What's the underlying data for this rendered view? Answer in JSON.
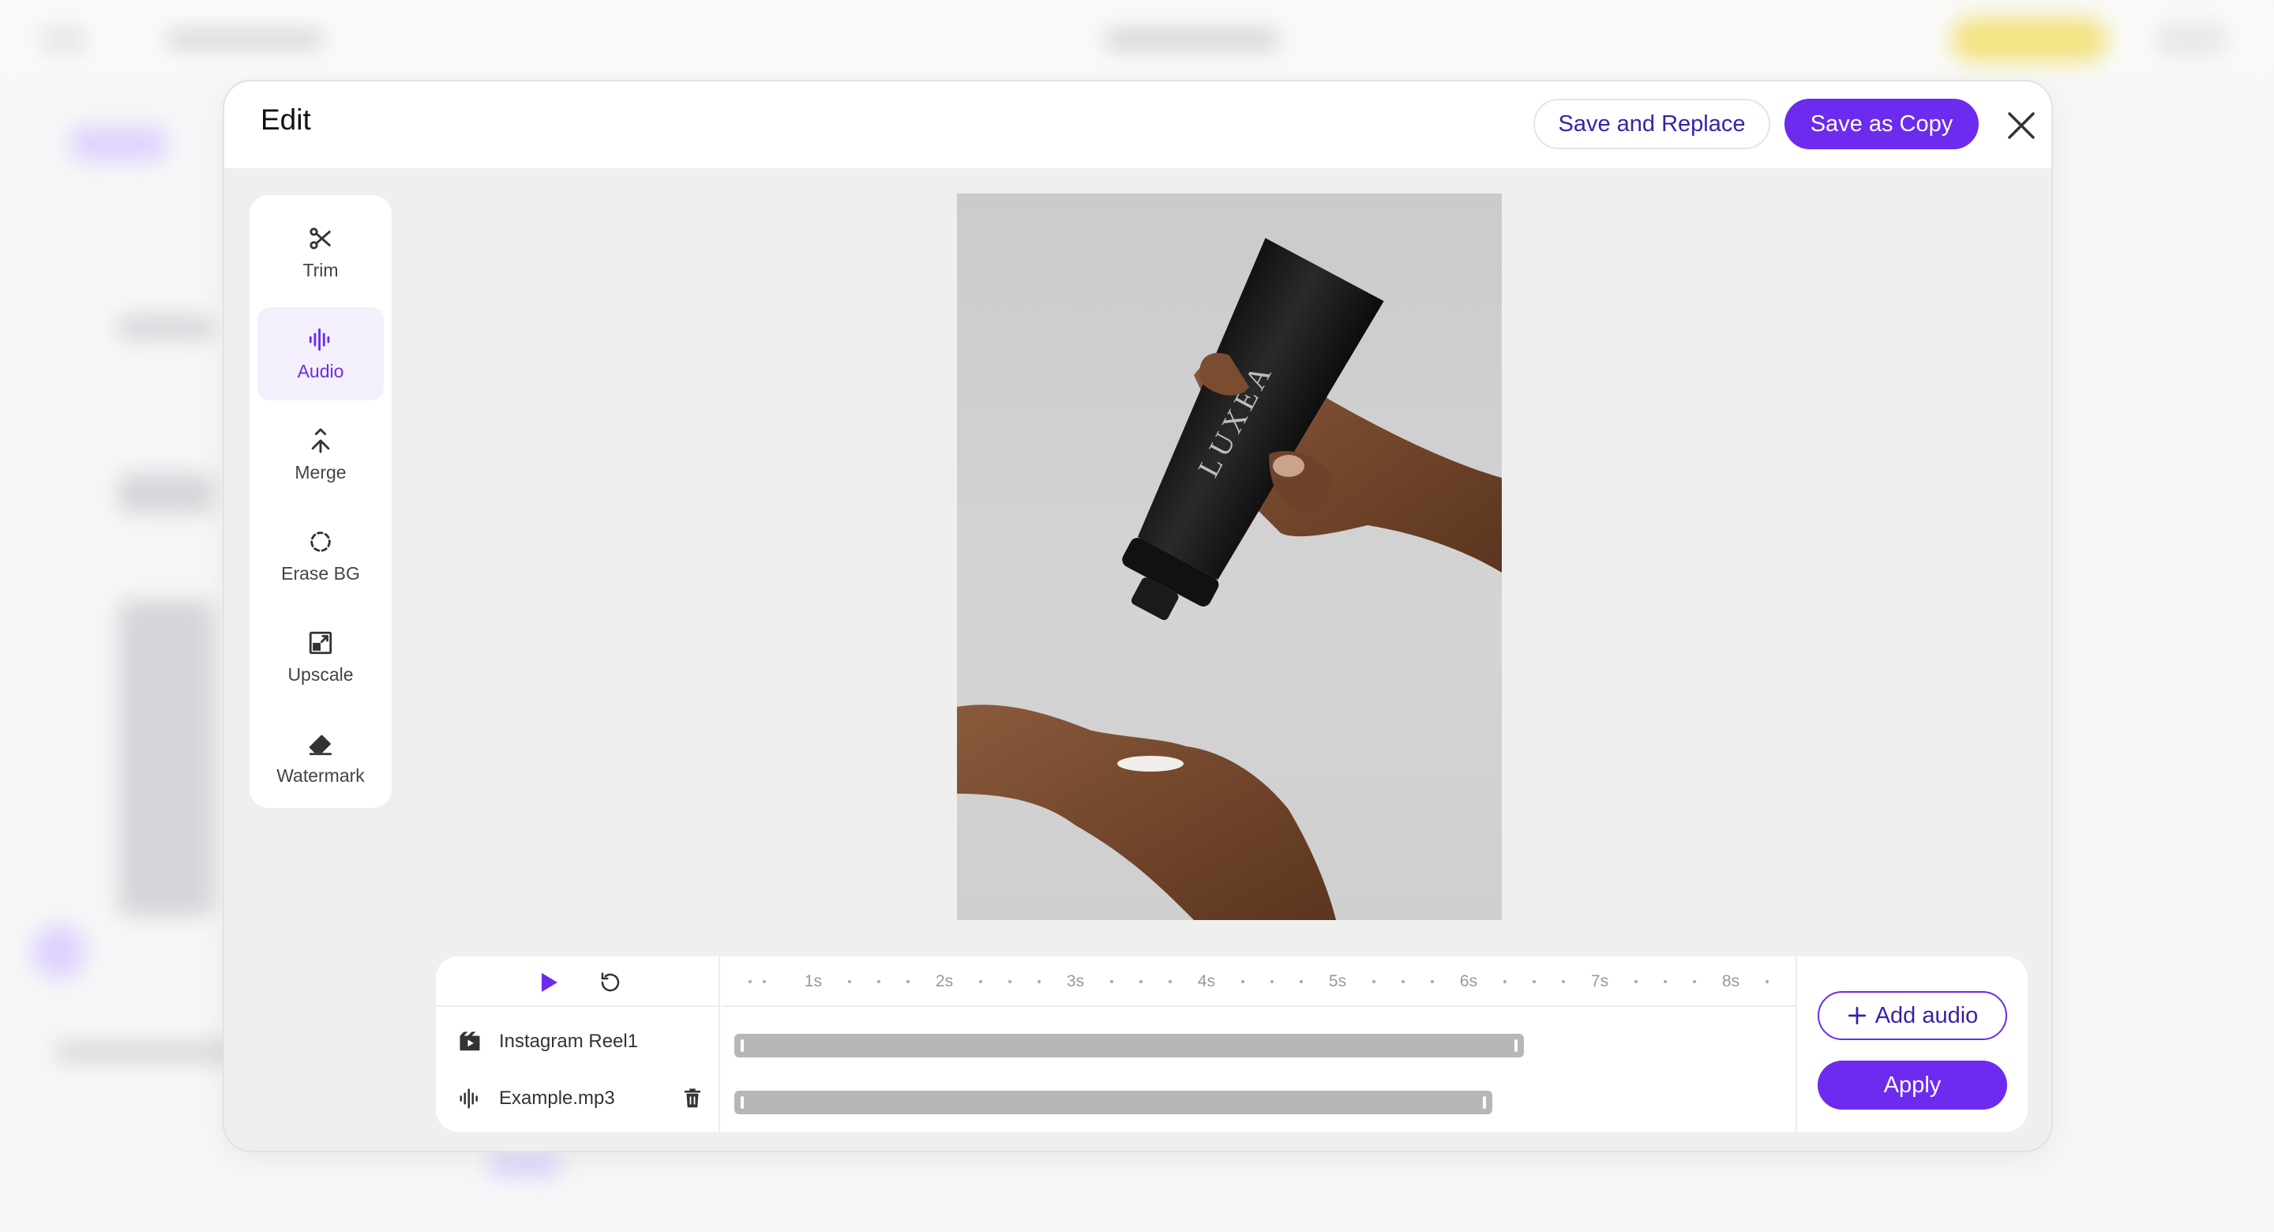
{
  "modal": {
    "title": "Edit",
    "save_replace_label": "Save and Replace",
    "save_copy_label": "Save as Copy",
    "close_icon": "close-icon"
  },
  "tools": [
    {
      "label": "Trim",
      "icon": "scissors-icon",
      "active": false
    },
    {
      "label": "Audio",
      "icon": "audio-wave-icon",
      "active": true
    },
    {
      "label": "Merge",
      "icon": "merge-icon",
      "active": false
    },
    {
      "label": "Erase BG",
      "icon": "erase-bg-icon",
      "active": false
    },
    {
      "label": "Upscale",
      "icon": "upscale-icon",
      "active": false
    },
    {
      "label": "Watermark",
      "icon": "eraser-icon",
      "active": false
    }
  ],
  "preview": {
    "product_text": "LUXEA"
  },
  "timeline": {
    "play_icon": "play-icon",
    "reset_icon": "reset-icon",
    "ruler": [
      "1s",
      "2s",
      "3s",
      "4s",
      "5s",
      "6s",
      "7s",
      "8s"
    ],
    "tracks": [
      {
        "name": "Instagram Reel1",
        "icon": "video-clip-icon",
        "deletable": false
      },
      {
        "name": "Example.mp3",
        "icon": "audio-wave-icon",
        "deletable": true
      }
    ],
    "add_audio_label": "Add audio",
    "apply_label": "Apply"
  },
  "colors": {
    "accent": "#6c2bef",
    "accent_text": "#3b1fa8",
    "track_bar": "#b7b7b7"
  }
}
